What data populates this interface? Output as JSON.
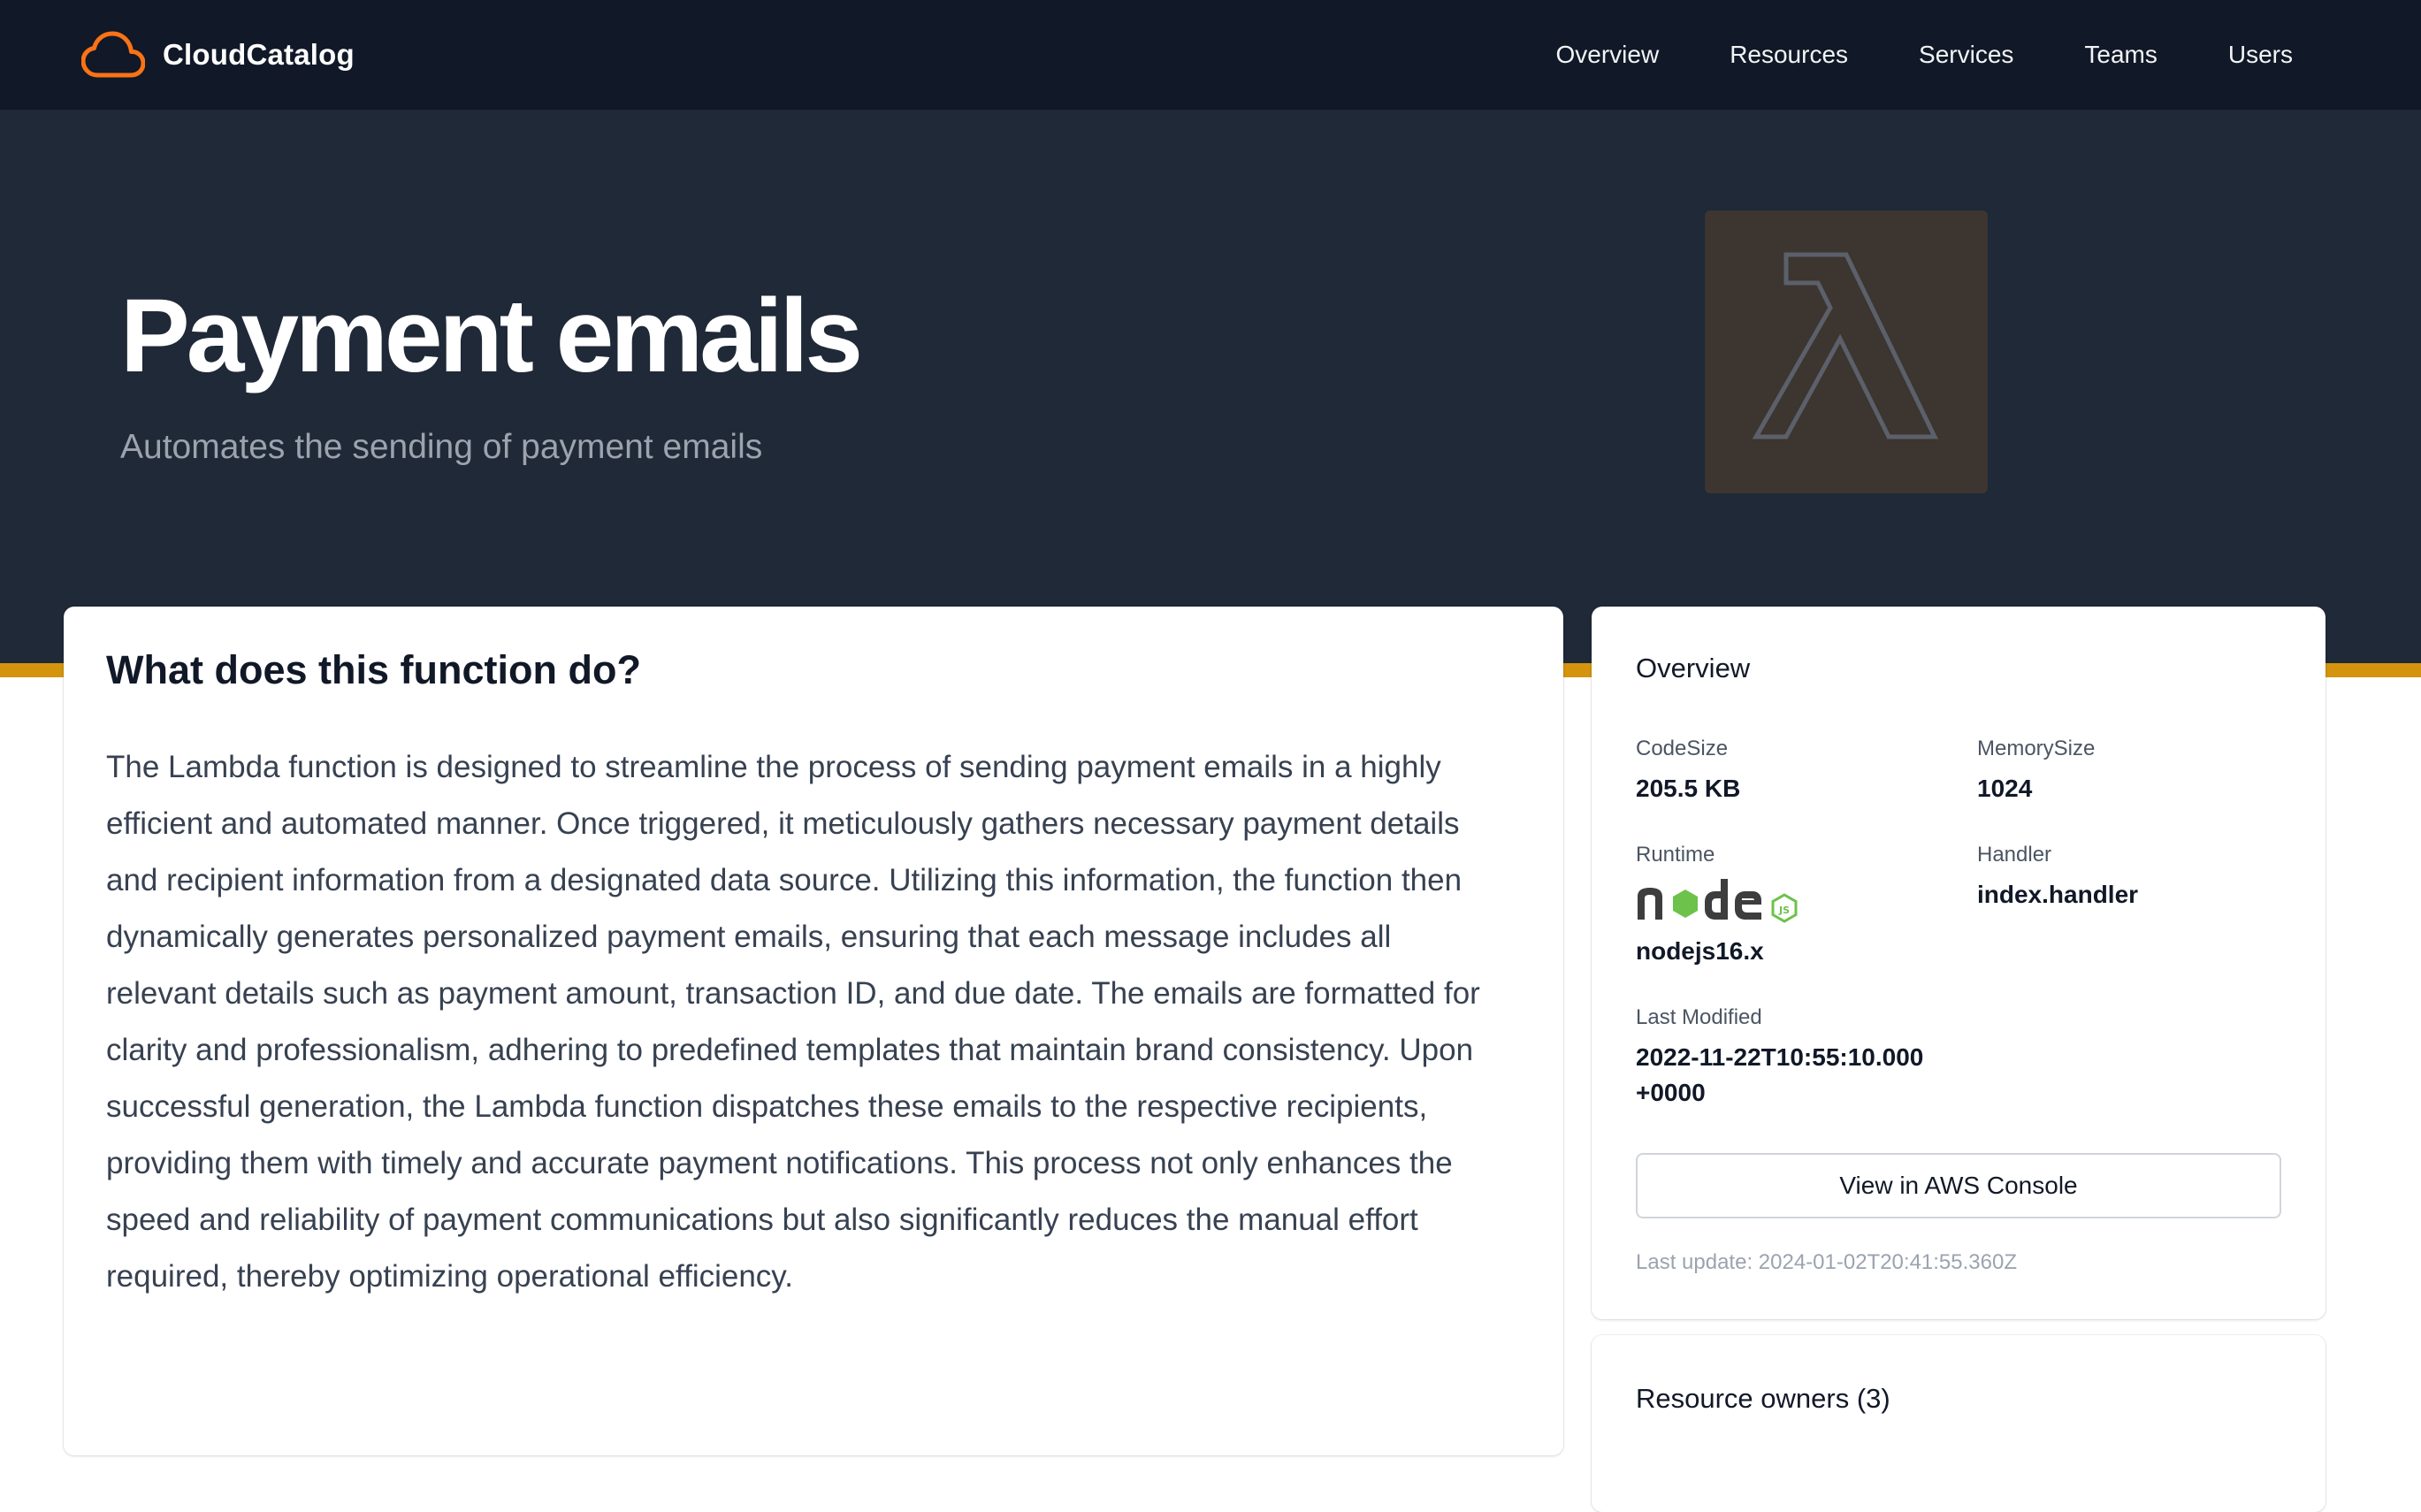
{
  "brand": {
    "name": "CloudCatalog",
    "logo_icon": "cloud-icon",
    "logo_color": "#f97316"
  },
  "nav": {
    "items": [
      {
        "label": "Overview"
      },
      {
        "label": "Resources"
      },
      {
        "label": "Services"
      },
      {
        "label": "Teams"
      },
      {
        "label": "Users"
      }
    ]
  },
  "hero": {
    "title": "Payment emails",
    "subtitle": "Automates the sending of payment emails",
    "service_icon": "aws-lambda-icon",
    "accent_color": "#d4940e"
  },
  "description": {
    "heading": "What does this function do?",
    "body": "The Lambda function is designed to streamline the process of sending payment emails in a highly efficient and automated manner. Once triggered, it meticulously gathers necessary payment details and recipient information from a designated data source. Utilizing this information, the function then dynamically generates personalized payment emails, ensuring that each message includes all relevant details such as payment amount, transaction ID, and due date. The emails are formatted for clarity and professionalism, adhering to predefined templates that maintain brand consistency. Upon successful generation, the Lambda function dispatches these emails to the respective recipients, providing them with timely and accurate payment notifications. This process not only enhances the speed and reliability of payment communications but also significantly reduces the manual effort required, thereby optimizing operational efficiency."
  },
  "overview": {
    "title": "Overview",
    "fields": {
      "code_size": {
        "label": "CodeSize",
        "value": "205.5 KB"
      },
      "memory_size": {
        "label": "MemorySize",
        "value": "1024"
      },
      "runtime": {
        "label": "Runtime",
        "value": "nodejs16.x",
        "icon": "nodejs-logo-icon"
      },
      "handler": {
        "label": "Handler",
        "value": "index.handler"
      },
      "last_modified": {
        "label": "Last Modified",
        "value": "2022-11-22T10:55:10.000+0000"
      }
    },
    "console_button": "View in AWS Console",
    "last_update": "Last update: 2024-01-02T20:41:55.360Z"
  },
  "owners": {
    "title": "Resource owners (3)"
  }
}
